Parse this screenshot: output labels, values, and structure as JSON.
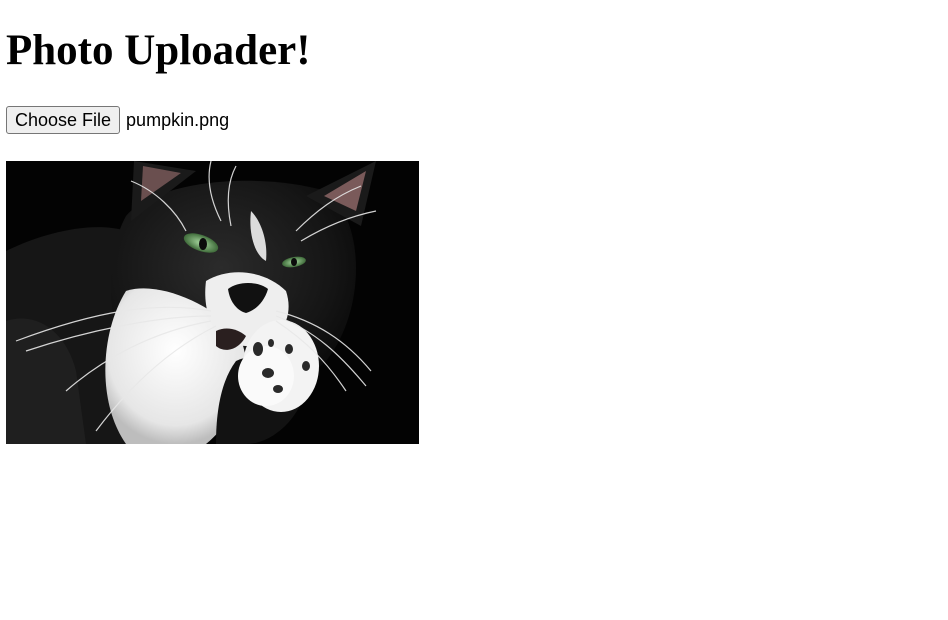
{
  "page": {
    "title": "Photo Uploader!"
  },
  "upload": {
    "button_label": "Choose File",
    "selected_file": "pumpkin.png"
  },
  "photo": {
    "subject": "black-and-white-cat-licking-paw"
  },
  "colors": {
    "background": "#ffffff",
    "button_bg": "#efefef",
    "button_border": "#767676",
    "photo_bg": "#050505"
  }
}
